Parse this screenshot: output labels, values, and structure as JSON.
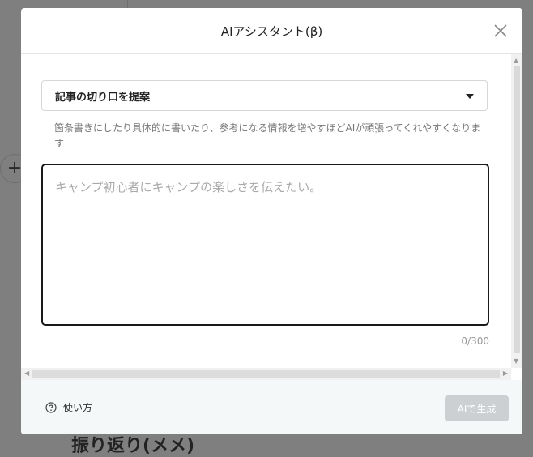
{
  "modal": {
    "title": "AIアシスタント(β)",
    "close_icon": "close-icon"
  },
  "form": {
    "select": {
      "selected": "記事の切り口を提案",
      "caret_icon": "caret-down-icon"
    },
    "hint": "箇条書きにしたり具体的に書いたり、参考になる情報を増やすほどAIが頑張ってくれやすくなります",
    "textarea": {
      "value": "",
      "placeholder": "キャンプ初心者にキャンプの楽しさを伝えたい。"
    },
    "counter": "0/300"
  },
  "footer": {
    "help_icon": "question-circle-icon",
    "help_label": "使い方",
    "generate_label": "AIで生成"
  },
  "background": {
    "add_icon": "plus-icon",
    "heading": "振り返り(メメ)"
  },
  "colors": {
    "overlay": "#7f7f7f",
    "modal_bg": "#ffffff",
    "footer_bg": "#f5f8f8",
    "textarea_border": "#1a1a1a",
    "button_disabled": "#cdd0d2"
  }
}
